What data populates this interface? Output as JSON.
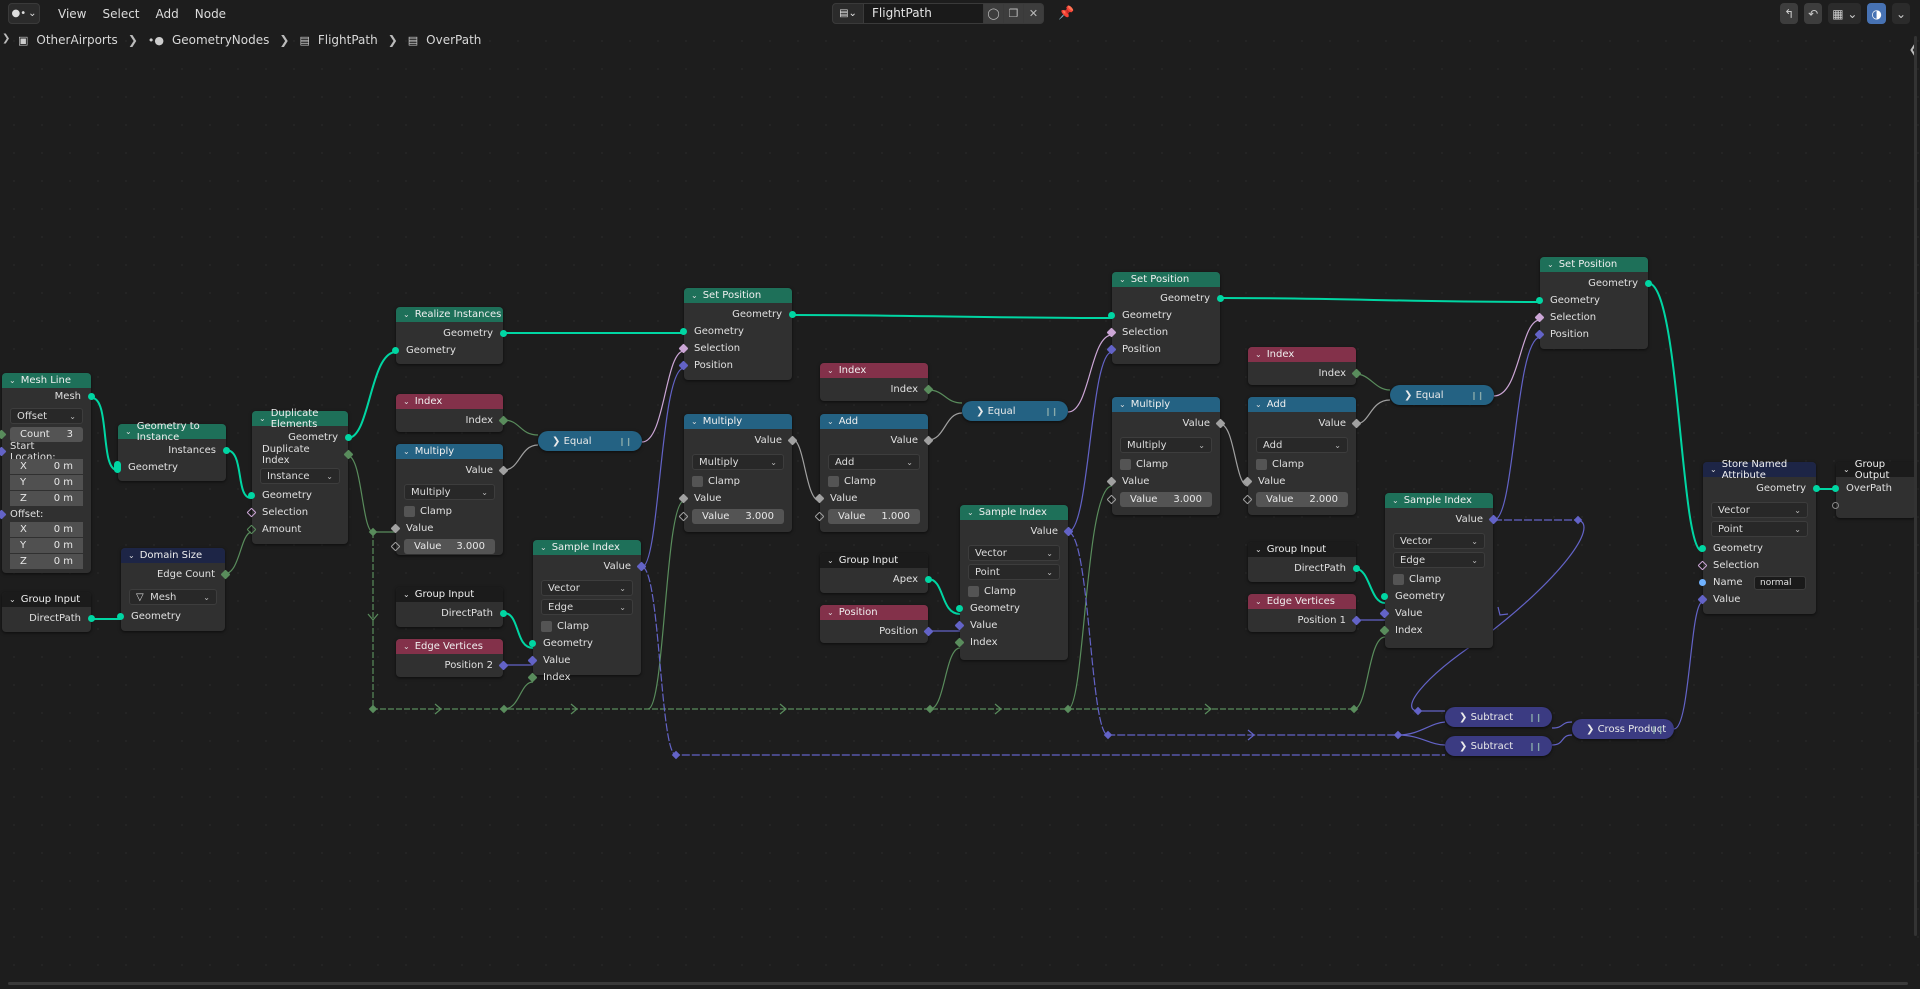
{
  "header": {
    "editor_icon": "geometry-nodes-icon",
    "menu": [
      "View",
      "Select",
      "Add",
      "Node"
    ],
    "node_tree_name": "FlightPath",
    "tree_buttons": [
      "fake-user-icon",
      "duplicate-icon",
      "close-icon"
    ],
    "pin_icon": "pin-icon",
    "right_tools": [
      "parent-icon",
      "snap-icon",
      "snap-grid-icon",
      "overlay-icon"
    ]
  },
  "breadcrumb": [
    {
      "icon": "object-icon",
      "label": "OtherAirports"
    },
    {
      "icon": "geometry-nodes-icon",
      "label": "GeometryNodes"
    },
    {
      "icon": "node-tree-icon",
      "label": "FlightPath"
    },
    {
      "icon": "node-tree-icon",
      "label": "OverPath"
    }
  ],
  "colors": {
    "geometry_header": "#1e7059",
    "input_header": "#83314a",
    "converter_header": "#246283",
    "attribute_header": "#1d2546",
    "geometry_socket": "#00d6a3",
    "integer_socket": "#598c5c",
    "vector_socket": "#6363c7",
    "boolean_socket": "#cca6d6",
    "float_socket": "#a1a1a1",
    "accent": "#4772b3"
  },
  "nodes": {
    "mesh_line": {
      "title": "Mesh Line",
      "out": "Mesh",
      "mode": "Offset",
      "count_label": "Count",
      "count": "3",
      "start_label": "Start Location:",
      "offset_label": "Offset:",
      "axes": [
        "X",
        "Y",
        "Z"
      ],
      "start": [
        "0 m",
        "0 m",
        "0 m"
      ],
      "offset": [
        "0 m",
        "0 m",
        "0 m"
      ]
    },
    "group_input_1": {
      "title": "Group Input",
      "out": "DirectPath"
    },
    "geo_to_inst": {
      "title": "Geometry to Instance",
      "out": "Instances",
      "in": "Geometry"
    },
    "domain_size": {
      "title": "Domain Size",
      "out": "Edge Count",
      "mode": "Mesh",
      "in": "Geometry"
    },
    "duplicate": {
      "title": "Duplicate Elements",
      "out1": "Geometry",
      "out2": "Duplicate Index",
      "domain": "Instance",
      "in1": "Geometry",
      "in2": "Selection",
      "in3": "Amount"
    },
    "realize": {
      "title": "Realize Instances",
      "out": "Geometry",
      "in": "Geometry"
    },
    "index_1": {
      "title": "Index",
      "out": "Index"
    },
    "multiply_1": {
      "title": "Multiply",
      "out": "Value",
      "op": "Multiply",
      "clamp": "Clamp",
      "in": "Value",
      "field_label": "Value",
      "field_value": "3.000"
    },
    "equal_1": {
      "title": "Equal"
    },
    "group_input_2": {
      "title": "Group Input",
      "out": "DirectPath"
    },
    "edge_vertices_1": {
      "title": "Edge Vertices",
      "out": "Position 2"
    },
    "sample_index_1": {
      "title": "Sample Index",
      "out": "Value",
      "type": "Vector",
      "domain": "Edge",
      "clamp": "Clamp",
      "in1": "Geometry",
      "in2": "Value",
      "in3": "Index"
    },
    "set_position_1": {
      "title": "Set Position",
      "out": "Geometry",
      "in1": "Geometry",
      "in2": "Selection",
      "in3": "Position"
    },
    "multiply_2": {
      "title": "Multiply",
      "out": "Value",
      "op": "Multiply",
      "clamp": "Clamp",
      "in": "Value",
      "field_label": "Value",
      "field_value": "3.000"
    },
    "index_2": {
      "title": "Index",
      "out": "Index"
    },
    "add_1": {
      "title": "Add",
      "out": "Value",
      "op": "Add",
      "clamp": "Clamp",
      "in": "Value",
      "field_label": "Value",
      "field_value": "1.000"
    },
    "equal_2": {
      "title": "Equal"
    },
    "group_input_3": {
      "title": "Group Input",
      "out": "Apex"
    },
    "position": {
      "title": "Position",
      "out": "Position"
    },
    "sample_index_2": {
      "title": "Sample Index",
      "out": "Value",
      "type": "Vector",
      "domain": "Point",
      "clamp": "Clamp",
      "in1": "Geometry",
      "in2": "Value",
      "in3": "Index"
    },
    "set_position_2": {
      "title": "Set Position",
      "out": "Geometry",
      "in1": "Geometry",
      "in2": "Selection",
      "in3": "Position"
    },
    "multiply_3": {
      "title": "Multiply",
      "out": "Value",
      "op": "Multiply",
      "clamp": "Clamp",
      "in": "Value",
      "field_label": "Value",
      "field_value": "3.000"
    },
    "index_3": {
      "title": "Index",
      "out": "Index"
    },
    "add_2": {
      "title": "Add",
      "out": "Value",
      "op": "Add",
      "clamp": "Clamp",
      "in": "Value",
      "field_label": "Value",
      "field_value": "2.000"
    },
    "equal_3": {
      "title": "Equal"
    },
    "group_input_4": {
      "title": "Group Input",
      "out": "DirectPath"
    },
    "edge_vertices_2": {
      "title": "Edge Vertices",
      "out": "Position 1"
    },
    "sample_index_3": {
      "title": "Sample Index",
      "out": "Value",
      "type": "Vector",
      "domain": "Edge",
      "clamp": "Clamp",
      "in1": "Geometry",
      "in2": "Value",
      "in3": "Index"
    },
    "set_position_3": {
      "title": "Set Position",
      "out": "Geometry",
      "in1": "Geometry",
      "in2": "Selection",
      "in3": "Position"
    },
    "subtract_1": {
      "title": "Subtract"
    },
    "subtract_2": {
      "title": "Subtract"
    },
    "cross_product": {
      "title": "Cross Product"
    },
    "store_attr": {
      "title": "Store Named Attribute",
      "out": "Geometry",
      "type": "Vector",
      "domain": "Point",
      "in1": "Geometry",
      "in2": "Selection",
      "in3": "Name",
      "name_value": "normal",
      "in4": "Value"
    },
    "group_output": {
      "title": "Group Output",
      "in": "OverPath"
    }
  }
}
